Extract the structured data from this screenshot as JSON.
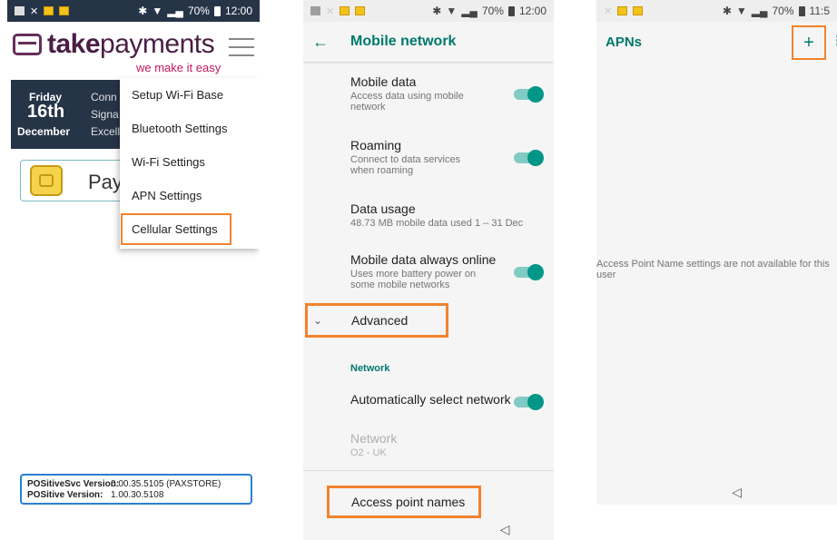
{
  "colors": {
    "accent_orange": "#f2832e",
    "teal": "#00796b",
    "navy": "#263448",
    "brand_purple": "#4a1e44",
    "tagline_pink": "#c2185b"
  },
  "phone1": {
    "status": {
      "battery": "70%",
      "time": "12:00"
    },
    "brand_bold": "take",
    "brand_rest": "payments",
    "tagline": "we make it easy",
    "date": {
      "day": "Friday",
      "date": "16th",
      "month": "December"
    },
    "info_lines": [
      "Conn",
      "Signa",
      "Excell"
    ],
    "pay_label": "Pay",
    "menu": [
      "Setup Wi-Fi Base",
      "Bluetooth Settings",
      "Wi-Fi Settings",
      "APN Settings",
      "Cellular Settings"
    ],
    "version": {
      "svc_label": "POSitiveSvc Version:",
      "svc_value": "0.00.35.5105 (PAXSTORE)",
      "pos_label": "POSitive Version:",
      "pos_value": "1.00.30.5108"
    }
  },
  "phone2": {
    "status": {
      "battery": "70%",
      "time": "12:00"
    },
    "title": "Mobile network",
    "settings": [
      {
        "title": "Mobile data",
        "subtitle": "Access data using mobile network"
      },
      {
        "title": "Roaming",
        "subtitle": "Connect to data services when roaming"
      },
      {
        "title": "Data usage",
        "subtitle": "48.73 MB mobile data used 1 – 31 Dec"
      },
      {
        "title": "Mobile data always online",
        "subtitle": "Uses more battery power on some mobile networks"
      }
    ],
    "advanced": "Advanced",
    "network_header": "Network",
    "auto_select": "Automatically select network",
    "network": {
      "title": "Network",
      "value": "O2 - UK"
    },
    "apn": "Access point names"
  },
  "phone3": {
    "status": {
      "battery": "70%",
      "time": "11:5"
    },
    "title": "APNs",
    "add": "+",
    "more": "⋮",
    "message_line1": "Access Point Name settings are not available for this",
    "message_line2": "user"
  }
}
